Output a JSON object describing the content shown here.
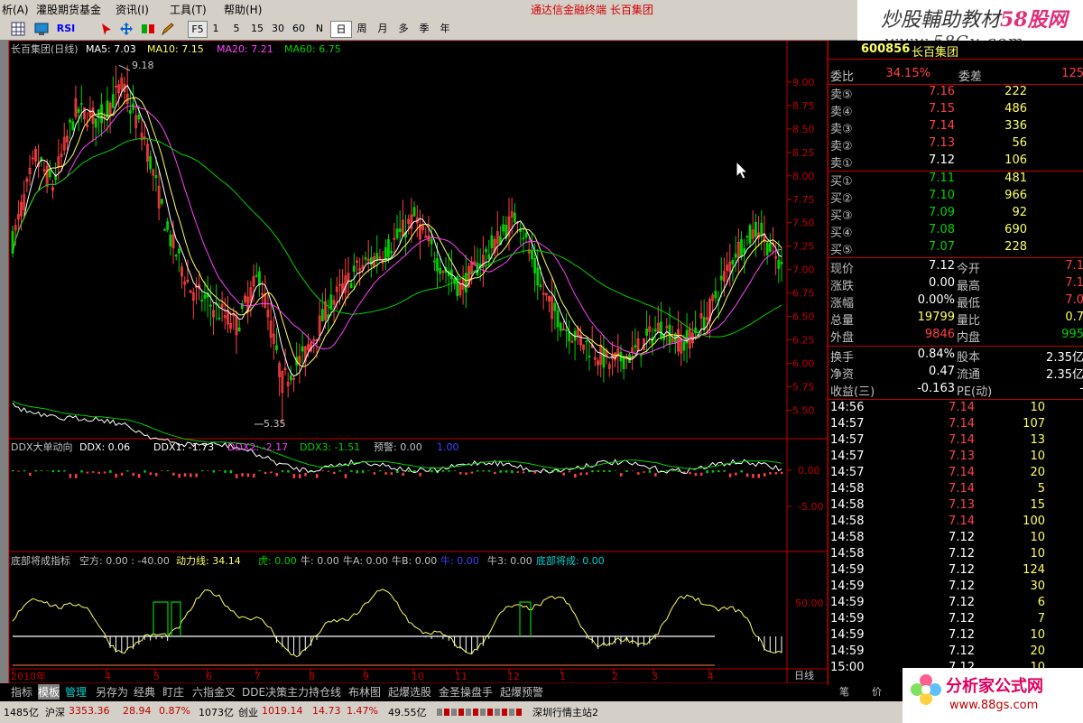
{
  "menu": {
    "items": [
      "析(A)",
      "灌股期货基金",
      "资讯(I)",
      "工具(T)",
      "帮助(H)"
    ],
    "ad_title": "通达信金融终端",
    "stock_name_top": "长百集团"
  },
  "toolbar": {
    "icons": [
      "grid-icon",
      "monitor-icon",
      "rsi-icon",
      "cursor-icon",
      "move-icon",
      "compare-icon",
      "target-icon",
      "pen-icon"
    ],
    "rsi_label": "RSI",
    "f5": "F5",
    "periods": [
      "1",
      "5",
      "15",
      "30",
      "60",
      "N",
      "日",
      "周",
      "月",
      "多",
      "季",
      "年"
    ],
    "selected": "日"
  },
  "watermark": {
    "line1_a": "炒股輔助教材",
    "line1_b": "58股网",
    "line2": "www.58Gu.com",
    "bottom_a": "分析家公式网",
    "bottom_b": "www.88gs.com"
  },
  "colors": {
    "up": "#ff4040",
    "down": "#00d000",
    "ma5": "#ffffff",
    "ma10": "#ffff60",
    "ma20": "#ff40ff",
    "ma60": "#00d000",
    "frame": "#c00000"
  },
  "main_chart": {
    "title": "长百集团(日线)",
    "ma5": "MA5: 7.03",
    "ma10": "MA10: 7.15",
    "ma20": "MA20: 7.21",
    "ma60": "MA60: 6.75",
    "high_label": "9.18",
    "low_label": "5.35",
    "yticks": [
      "9.00",
      "8.75",
      "8.50",
      "8.25",
      "8.00",
      "7.75",
      "7.50",
      "7.25",
      "7.00",
      "6.75",
      "6.50",
      "6.25",
      "6.00",
      "5.75",
      "5.50"
    ],
    "ylim": [
      5.35,
      9.25
    ]
  },
  "ddx": {
    "title": "DDX大单动向",
    "ddx": "DDX: 0.06",
    "ddx1": "DDX1: -1.73",
    "ddx2": "DDX2: -2.17",
    "ddx3": "DDX3: -1.51",
    "warn": "预警: 0.00",
    "extra": "1.00",
    "yticks": [
      "0.00",
      "-5.00"
    ]
  },
  "bottom_ind": {
    "title": "底部将成指标",
    "kong": "空方: 0.00 : -40.00",
    "dongli": "动力线: 34.14",
    "hu": "虎: 0.00",
    "niu": "牛: 0.00",
    "niuA": "牛A: 0.00",
    "niuB": "牛B: 0.00",
    "niuB2": "牛: 0.00",
    "niu3": "牛3: 0.00",
    "dibu": "底部将成: 0.00",
    "ytick": "50.00"
  },
  "xaxis": {
    "labels": [
      "2010年",
      "4",
      "5",
      "6",
      "7",
      "8",
      "9",
      "10",
      "11",
      "12",
      "1",
      "2",
      "3",
      "4"
    ],
    "period_label": "日线"
  },
  "tabs": [
    "指标",
    "模板",
    "管理",
    "另存为",
    "经典",
    "盯庄",
    "六指金叉",
    "DDE决策",
    "主力持仓线",
    "布林图",
    "起爆选股",
    "金圣操盘手",
    "起爆预警"
  ],
  "quote": {
    "code": "600856",
    "name": "长百集团",
    "weibi_label": "委比",
    "weibi": "34.15%",
    "weicha_label": "委差",
    "weicha": "125",
    "sells": [
      {
        "l": "卖⑤",
        "p": "7.16",
        "v": "222"
      },
      {
        "l": "卖④",
        "p": "7.15",
        "v": "486"
      },
      {
        "l": "卖③",
        "p": "7.14",
        "v": "336"
      },
      {
        "l": "卖②",
        "p": "7.13",
        "v": "56"
      },
      {
        "l": "卖①",
        "p": "7.12",
        "v": "106"
      }
    ],
    "buys": [
      {
        "l": "买①",
        "p": "7.11",
        "v": "481"
      },
      {
        "l": "买②",
        "p": "7.10",
        "v": "966"
      },
      {
        "l": "买③",
        "p": "7.09",
        "v": "92"
      },
      {
        "l": "买④",
        "p": "7.08",
        "v": "690"
      },
      {
        "l": "买⑤",
        "p": "7.07",
        "v": "228"
      }
    ],
    "stats": [
      {
        "a": "现价",
        "av": "7.12",
        "b": "今开",
        "bv": "7.1"
      },
      {
        "a": "涨跌",
        "av": "0.00",
        "b": "最高",
        "bv": "7.1"
      },
      {
        "a": "涨幅",
        "av": "0.00%",
        "b": "最低",
        "bv": "7.0"
      },
      {
        "a": "总量",
        "av": "19799",
        "b": "量比",
        "bv": "0.7"
      },
      {
        "a": "外盘",
        "av": "9846",
        "b": "内盘",
        "bv": "995"
      }
    ],
    "stats2": [
      {
        "a": "换手",
        "av": "0.84%",
        "b": "股本",
        "bv": "2.35亿"
      },
      {
        "a": "净资",
        "av": "0.47",
        "b": "流通",
        "bv": "2.35亿"
      },
      {
        "a": "收益(三)",
        "av": "-0.163",
        "b": "PE(动)",
        "bv": "-"
      }
    ],
    "ticks": [
      {
        "t": "14:56",
        "p": "7.14",
        "v": "10"
      },
      {
        "t": "14:57",
        "p": "7.14",
        "v": "107"
      },
      {
        "t": "14:57",
        "p": "7.14",
        "v": "13"
      },
      {
        "t": "14:57",
        "p": "7.13",
        "v": "10"
      },
      {
        "t": "14:57",
        "p": "7.14",
        "v": "20"
      },
      {
        "t": "14:58",
        "p": "7.14",
        "v": "5"
      },
      {
        "t": "14:58",
        "p": "7.13",
        "v": "15"
      },
      {
        "t": "14:58",
        "p": "7.14",
        "v": "100"
      },
      {
        "t": "14:58",
        "p": "7.12",
        "v": "10"
      },
      {
        "t": "14:58",
        "p": "7.12",
        "v": "10"
      },
      {
        "t": "14:59",
        "p": "7.12",
        "v": "124"
      },
      {
        "t": "14:59",
        "p": "7.12",
        "v": "30"
      },
      {
        "t": "14:59",
        "p": "7.12",
        "v": "6"
      },
      {
        "t": "14:59",
        "p": "7.12",
        "v": "7"
      },
      {
        "t": "14:59",
        "p": "7.12",
        "v": "10"
      },
      {
        "t": "14:59",
        "p": "7.12",
        "v": "20"
      },
      {
        "t": "15:00",
        "p": "7.12",
        "v": "10"
      }
    ],
    "panel_tabs": [
      "笔",
      "价"
    ]
  },
  "status": {
    "a": "1485亿",
    "sh_label": "沪深",
    "sh": "3353.36",
    "sh_chg": "28.94",
    "sh_pct": "0.87%",
    "sh_amt": "1073亿",
    "cy_label": "创业",
    "cy": "1019.14",
    "cy_chg": "14.73",
    "cy_pct": "1.47%",
    "cy_amt": "49.55亿",
    "server": "深圳行情主站2"
  }
}
